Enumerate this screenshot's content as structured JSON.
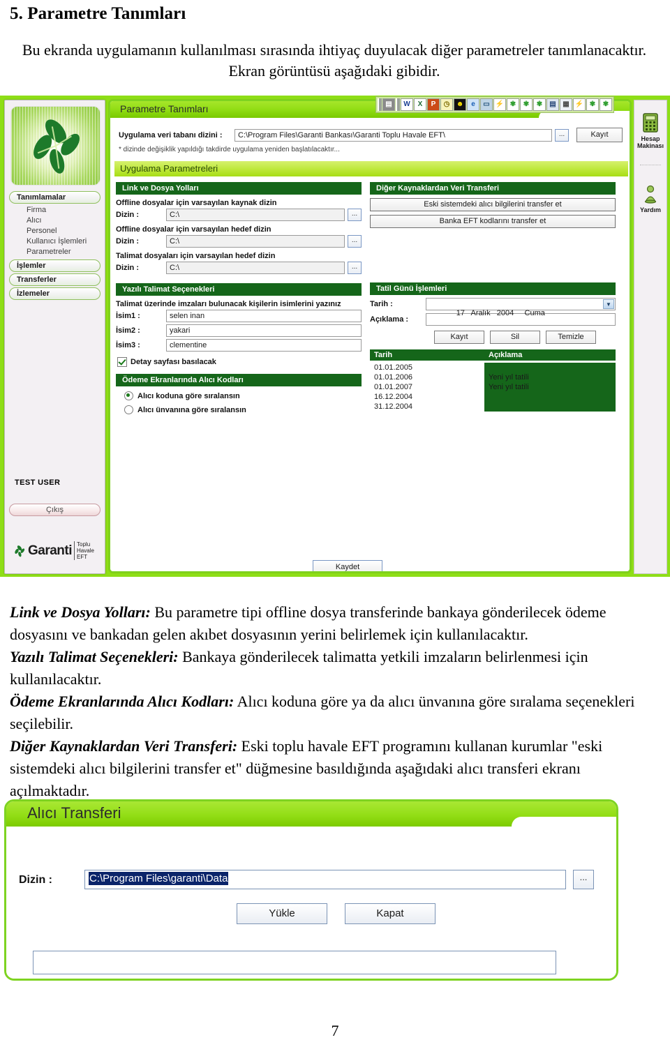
{
  "document": {
    "heading": "5. Parametre Tanımları",
    "intro": "Bu ekranda uygulamanın kullanılması sırasında ihtiyaç duyulacak diğer parametreler tanımlanacaktır. Ekran görüntüsü aşağıdaki gibidir.",
    "page_number": "7",
    "explanations": [
      {
        "term": "Link ve Dosya Yolları:",
        "text": " Bu parametre tipi offline dosya transferinde bankaya gönderilecek ödeme dosyasını ve bankadan gelen akıbet dosyasının yerini belirlemek için kullanılacaktır."
      },
      {
        "term": "Yazılı Talimat Seçenekleri:",
        "text": " Bankaya gönderilecek talimatta yetkili imzaların belirlenmesi için kullanılacaktır."
      },
      {
        "term": "Ödeme Ekranlarında Alıcı Kodları:",
        "text": " Alıcı koduna göre ya da alıcı ünvanına göre sıralama seçenekleri seçilebilir."
      },
      {
        "term": "Diğer Kaynaklardan Veri Transferi:",
        "text": "  Eski toplu havale EFT programını kullanan kurumlar \"eski sistemdeki alıcı bilgilerini transfer et\" düğmesine basıldığında aşağıdaki alıcı transferi ekranı açılmaktadır."
      }
    ]
  },
  "colors": {
    "title_green_light": "#8fdc12",
    "section_header_green": "#15661a",
    "desktop_green": "#8ede17",
    "window_border_green": "#7ed321",
    "selection_blue": "#0a246a"
  },
  "app": {
    "window_title": "Parametre Tanımları",
    "quicklaunch": [
      {
        "name": "show-desktop-icon",
        "glyph": "▤"
      },
      {
        "name": "word-icon",
        "glyph": "W"
      },
      {
        "name": "excel-icon",
        "glyph": "X"
      },
      {
        "name": "powerpoint-icon",
        "glyph": "P"
      },
      {
        "name": "clock-icon",
        "glyph": "◷"
      },
      {
        "name": "smiley-icon",
        "glyph": "☻"
      },
      {
        "name": "internet-explorer-icon",
        "glyph": "e"
      },
      {
        "name": "monitor-icon",
        "glyph": "▭"
      },
      {
        "name": "lightning-icon",
        "glyph": "⚡"
      },
      {
        "name": "clover-icon",
        "glyph": "✾"
      },
      {
        "name": "clover-icon",
        "glyph": "✾"
      },
      {
        "name": "clover-icon",
        "glyph": "✾"
      },
      {
        "name": "printer-icon",
        "glyph": "🖶"
      },
      {
        "name": "calendar-icon",
        "glyph": "▦"
      },
      {
        "name": "lightning-icon",
        "glyph": "⚡"
      },
      {
        "name": "clover-icon",
        "glyph": "✾"
      },
      {
        "name": "clover-icon",
        "glyph": "✾"
      }
    ],
    "sidebar": {
      "logo_name": "clover-logo",
      "groups": [
        {
          "label": "Tanımlamalar",
          "items": [
            "Firma",
            "Alıcı",
            "Personel",
            "Kullanıcı İşlemleri",
            "Parametreler"
          ]
        },
        {
          "label": "İşlemler",
          "items": []
        },
        {
          "label": "Transferler",
          "items": []
        },
        {
          "label": "İzlemeler",
          "items": []
        }
      ],
      "user": "TEST USER",
      "exit_label": "Çıkış",
      "brand_name": "Garanti",
      "brand_sub_line1": "Toplu",
      "brand_sub_line2": "Havale",
      "brand_sub_line3": "EFT"
    },
    "db_row": {
      "label": "Uygulama veri tabanı dizini :",
      "value": "C:\\Program Files\\Garanti Bankası\\Garanti Toplu Havale EFT\\",
      "browse_label": "...",
      "save_label": "Kayıt",
      "note": "* dizinde değişiklik yapıldığı takdirde uygulama yeniden başlatılacaktır..."
    },
    "section_title": "Uygulama Parametreleri",
    "panel_links": {
      "header": "Link ve Dosya Yolları",
      "groups": [
        {
          "caption": "Offline dosyalar için varsayılan kaynak dizin",
          "field_label": "Dizin :",
          "value": "C:\\"
        },
        {
          "caption": "Offline dosyalar için varsayılan hedef dizin",
          "field_label": "Dizin :",
          "value": "C:\\"
        },
        {
          "caption": "Talimat dosyaları için varsayılan hedef dizin",
          "field_label": "Dizin :",
          "value": "C:\\"
        }
      ],
      "browse_label": "..."
    },
    "panel_instructions": {
      "header": "Yazılı Talimat Seçenekleri",
      "caption": "Talimat üzerinde imzaları bulunacak kişilerin isimlerini yazınız",
      "fields": [
        {
          "label": "İsim1 :",
          "value": "selen inan"
        },
        {
          "label": "İsim2 :",
          "value": "yakari"
        },
        {
          "label": "İsim3 :",
          "value": "clementine"
        }
      ],
      "checkbox_label": "Detay sayfası basılacak",
      "checkbox_checked": true
    },
    "panel_codes": {
      "header": "Ödeme Ekranlarında Alıcı Kodları",
      "options": [
        {
          "label": "Alıcı koduna göre sıralansın",
          "selected": true
        },
        {
          "label": "Alıcı ünvanına göre sıralansın",
          "selected": false
        }
      ]
    },
    "panel_transfer": {
      "header": "Diğer Kaynaklardan Veri Transferi",
      "buttons": [
        "Eski sistemdeki alıcı bilgilerini transfer et",
        "Banka EFT kodlarını transfer et"
      ]
    },
    "panel_holiday": {
      "header": "Tatil Günü İşlemleri",
      "date_label": "Tarih :",
      "date_value": "17   Aralık   2004     Cuma",
      "desc_label": "Açıklama :",
      "desc_value": "",
      "buttons": [
        "Kayıt",
        "Sil",
        "Temizle"
      ],
      "grid_headers": [
        "Tarih",
        "Açıklama"
      ],
      "grid_rows": [
        {
          "date": "01.01.2005",
          "desc": ""
        },
        {
          "date": "01.01.2006",
          "desc": "Yeni yıl tatili"
        },
        {
          "date": "01.01.2007",
          "desc": "Yeni yıl tatili"
        },
        {
          "date": "16.12.2004",
          "desc": ""
        },
        {
          "date": "31.12.2004",
          "desc": ""
        }
      ]
    },
    "save_button": "Kaydet",
    "tool_rail": [
      {
        "icon": "calculator-icon",
        "line1": "Hesap",
        "line2": "Makinası"
      },
      {
        "icon": "help-person-icon",
        "line1": "Yardım",
        "line2": ""
      }
    ]
  },
  "dialog": {
    "title": "Alıcı Transferi",
    "dir_label": "Dizin :",
    "dir_value": "C:\\Program Files\\garanti\\Data",
    "browse_label": "...",
    "load_button": "Yükle",
    "close_button": "Kapat",
    "status_value": ""
  }
}
